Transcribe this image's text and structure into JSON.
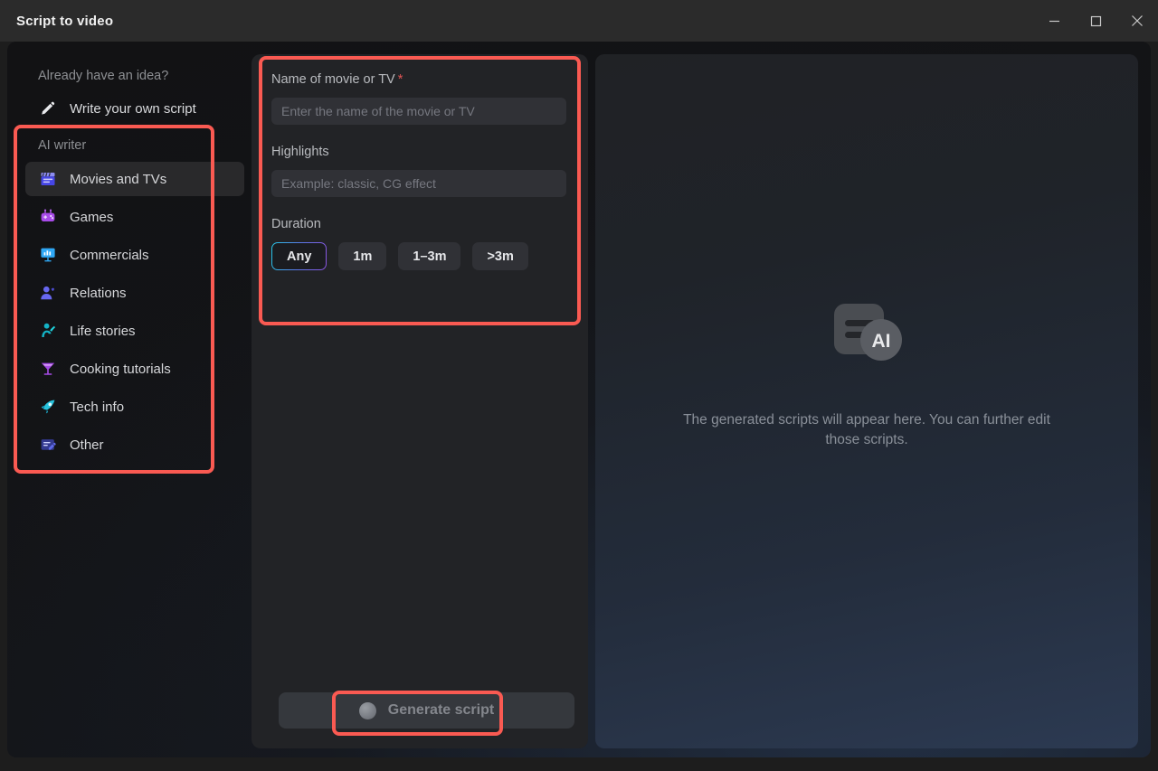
{
  "window": {
    "title": "Script to video",
    "controls": [
      {
        "name": "minimize",
        "glyph": "minimize-icon"
      },
      {
        "name": "maximize",
        "glyph": "maximize-icon"
      },
      {
        "name": "close",
        "glyph": "close-icon"
      }
    ]
  },
  "sidebar": {
    "idea_heading": "Already have an idea?",
    "own_script": {
      "label": "Write your own script",
      "icon": "pencil-icon"
    },
    "section_title": "AI writer",
    "items": [
      {
        "label": "Movies and TVs",
        "icon": "clapperboard-icon",
        "active": true
      },
      {
        "label": "Games",
        "icon": "gamepad-icon",
        "active": false
      },
      {
        "label": "Commercials",
        "icon": "presentation-board-icon",
        "active": false
      },
      {
        "label": "Relations",
        "icon": "person-heart-icon",
        "active": false
      },
      {
        "label": "Life stories",
        "icon": "person-raising-hand-icon",
        "active": false
      },
      {
        "label": "Cooking tutorials",
        "icon": "cocktail-glass-icon",
        "active": false
      },
      {
        "label": "Tech info",
        "icon": "rocket-icon",
        "active": false
      },
      {
        "label": "Other",
        "icon": "note-edit-icon",
        "active": false
      }
    ]
  },
  "form": {
    "name_label": "Name of movie or TV",
    "name_required_mark": "*",
    "name_value": "",
    "name_placeholder": "Enter the name of the movie or TV",
    "highlights_label": "Highlights",
    "highlights_value": "",
    "highlights_placeholder": "Example: classic, CG effect",
    "duration_label": "Duration",
    "duration_options": [
      {
        "label": "Any",
        "selected": true
      },
      {
        "label": "1m",
        "selected": false
      },
      {
        "label": "1–3m",
        "selected": false
      },
      {
        "label": ">3m",
        "selected": false
      }
    ],
    "generate_button": {
      "label": "Generate script",
      "icon": "ai-sphere-icon",
      "enabled": false
    }
  },
  "preview": {
    "empty_icon": "ai-document-icon",
    "empty_badge_text": "AI",
    "empty_message": "The generated scripts will appear here. You can further edit those scripts."
  },
  "annotations": [
    {
      "name": "ai-writer-list-highlight"
    },
    {
      "name": "script-settings-form-highlight"
    },
    {
      "name": "generate-script-button-highlight"
    }
  ],
  "colors": {
    "annotation": "#fa5a52",
    "required_star": "#e25555",
    "selected_border_start": "#26c8e8",
    "selected_border_end": "#8b54e0",
    "titlebar": "#2b2b2b"
  }
}
